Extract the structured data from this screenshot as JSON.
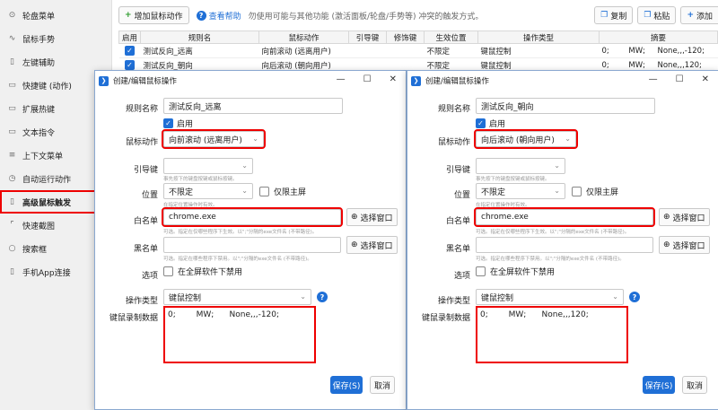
{
  "sidebar": {
    "items": [
      {
        "label": "轮盘菜单",
        "icon": "wheel-icon",
        "glyph": "⊙"
      },
      {
        "label": "鼠标手势",
        "icon": "gesture-icon",
        "glyph": "∿"
      },
      {
        "label": "左键辅助",
        "icon": "mouse-icon",
        "glyph": "▯"
      },
      {
        "label": "快捷键 (动作)",
        "icon": "keyboard-icon",
        "glyph": "▭"
      },
      {
        "label": "扩展热键",
        "icon": "extend-key-icon",
        "glyph": "▭"
      },
      {
        "label": "文本指令",
        "icon": "text-icon",
        "glyph": "▭"
      },
      {
        "label": "上下文菜单",
        "icon": "menu-icon",
        "glyph": "≡"
      },
      {
        "label": "自动运行动作",
        "icon": "auto-run-icon",
        "glyph": "◷"
      },
      {
        "label": "高级鼠标触发",
        "icon": "mouse-advanced-icon",
        "glyph": "▯"
      },
      {
        "label": "快速截图",
        "icon": "screenshot-icon",
        "glyph": "⌜"
      },
      {
        "label": "搜索框",
        "icon": "search-icon",
        "glyph": "○"
      },
      {
        "label": "手机App连接",
        "icon": "phone-icon",
        "glyph": "▯"
      }
    ]
  },
  "toolbar": {
    "add_label": "增加鼠标动作",
    "add_icon": "+",
    "help_label": "查看帮助",
    "warning": "勿使用可能与其他功能 (激活面板/轮盘/手势等) 冲突的触发方式。",
    "copy_label": "复制",
    "paste_label": "粘贴",
    "add2_label": "添加"
  },
  "table": {
    "headers": [
      "启用",
      "规则名",
      "鼠标动作",
      "引导键",
      "修饰键",
      "生效位置",
      "操作类型",
      "摘要"
    ],
    "rows": [
      {
        "enabled": true,
        "name": "测试反向_远离",
        "action": "向前滚动 (远离用户)",
        "guide": "",
        "modifier": "",
        "position": "不限定",
        "type": "键鼠控制",
        "summary": "0;        MW;     None,,,-120;"
      },
      {
        "enabled": true,
        "name": "测试反向_朝向",
        "action": "向后滚动 (朝向用户)",
        "guide": "",
        "modifier": "",
        "position": "不限定",
        "type": "键鼠控制",
        "summary": "0;        MW;     None,,,120;"
      }
    ]
  },
  "dialogs": [
    {
      "title": "创建/编辑鼠标操作",
      "labels": {
        "name": "规则名称",
        "enable": "启用",
        "action": "鼠标动作",
        "guide": "引导键",
        "position": "位置",
        "primary_only": "仅限主屏",
        "whitelist": "白名单",
        "select_window": "选择窗口",
        "blacklist": "黑名单",
        "options": "选项",
        "fullscreen": "在全屏软件下禁用",
        "op_type": "操作类型",
        "data": "键鼠录制数据",
        "save": "保存(S)",
        "cancel": "取消"
      },
      "hints": {
        "guide": "事先按下的键盘按键或鼠标按键。",
        "position": "在指定位置操作时有效。",
        "whitelist": "可选。指定在仅哪些程序下生效。以\";\"分隔的exe文件名 (不带路径)。",
        "blacklist": "可选。指定在哪些程序下禁用。以\";\"分隔的exe文件名 (不带路径)。"
      },
      "name": "测试反向_远离",
      "action": "向前滚动 (远离用户)",
      "guide": "",
      "position": "不限定",
      "whitelist": "chrome.exe",
      "blacklist": "",
      "op_type": "键鼠控制",
      "data": "0;        MW;      None,,,-120;"
    },
    {
      "title": "创建/编辑鼠标操作",
      "labels": {
        "name": "规则名称",
        "enable": "启用",
        "action": "鼠标动作",
        "guide": "引导键",
        "position": "位置",
        "primary_only": "仅限主屏",
        "whitelist": "白名单",
        "select_window": "选择窗口",
        "blacklist": "黑名单",
        "options": "选项",
        "fullscreen": "在全屏软件下禁用",
        "op_type": "操作类型",
        "data": "键鼠录制数据",
        "save": "保存(S)",
        "cancel": "取消"
      },
      "hints": {
        "guide": "事先按下的键盘按键或鼠标按键。",
        "position": "在指定位置操作时有效。",
        "whitelist": "可选。指定在仅哪些程序下生效。以\";\"分隔的exe文件名 (不带路径)。",
        "blacklist": "可选。指定在哪些程序下禁用。以\";\"分隔的exe文件名 (不带路径)。"
      },
      "name": "测试反向_朝向",
      "action": "向后滚动 (朝向用户)",
      "guide": "",
      "position": "不限定",
      "whitelist": "chrome.exe",
      "blacklist": "",
      "op_type": "键鼠控制",
      "data": "0;        MW;      None,,,120;"
    }
  ],
  "colors": {
    "accent": "#1f6fd6",
    "highlight": "#e00000"
  }
}
